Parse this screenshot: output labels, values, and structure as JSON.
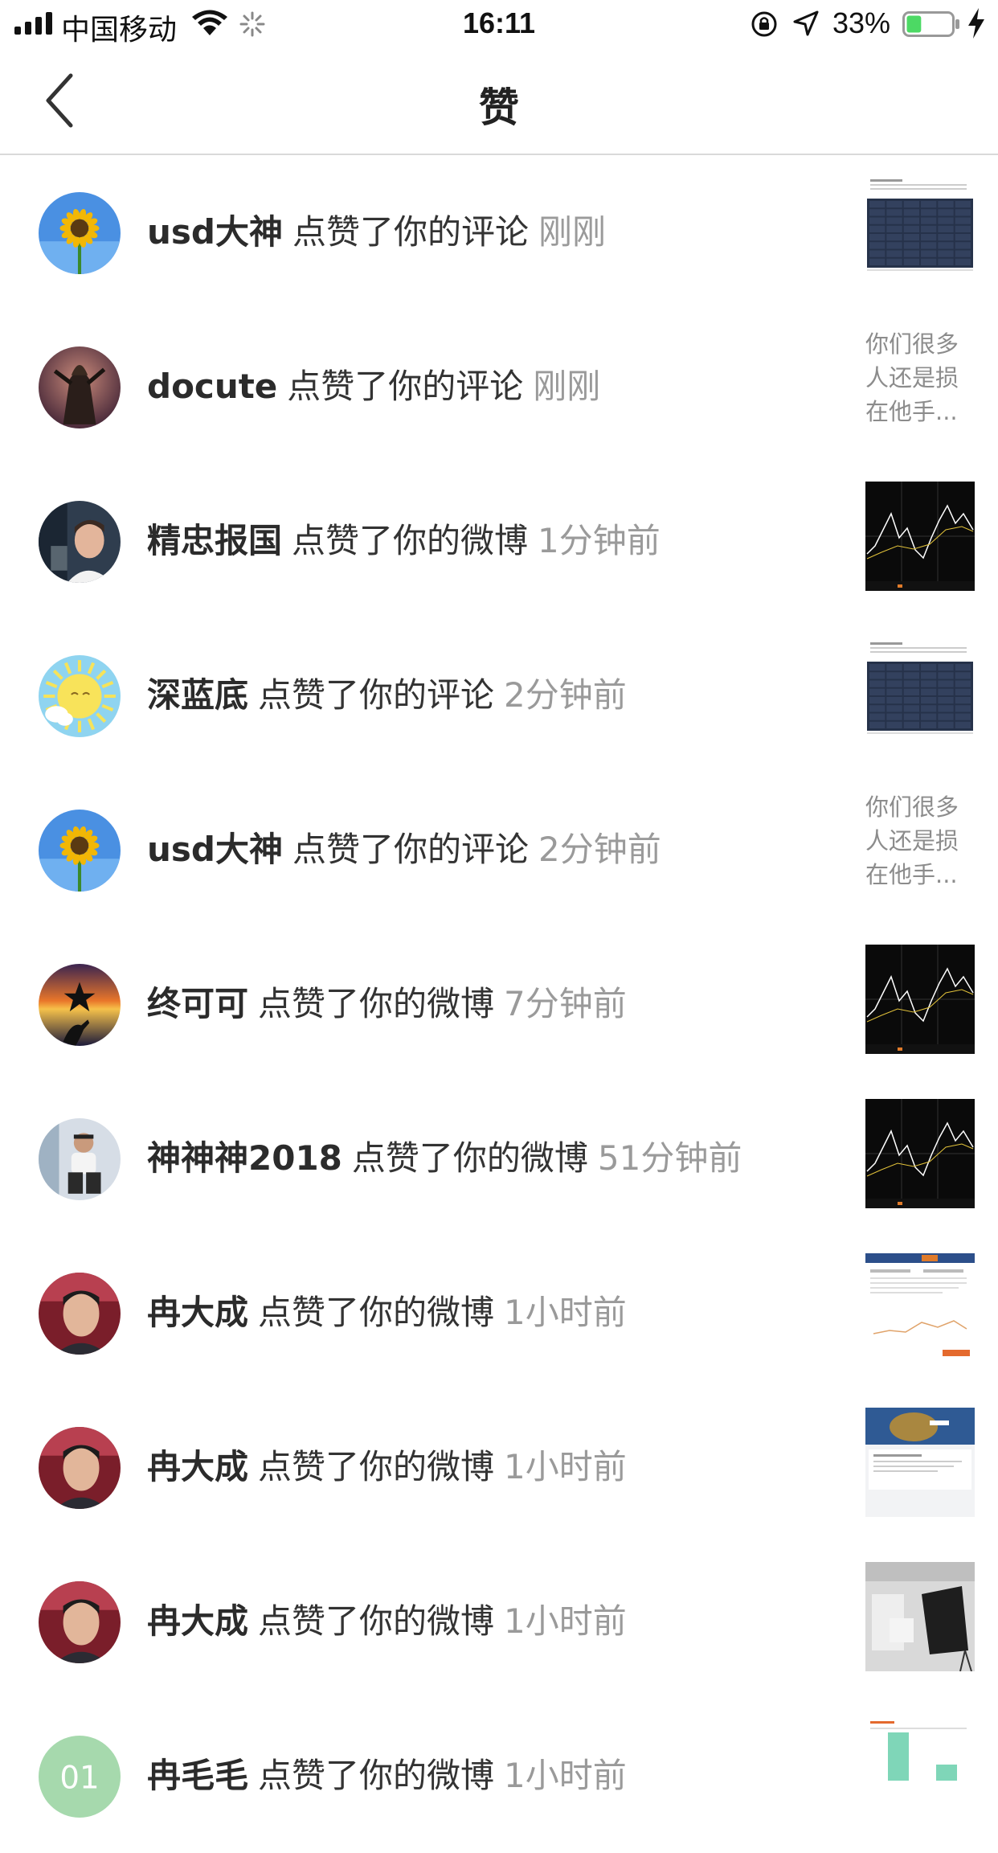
{
  "status_bar": {
    "carrier": "中国移动",
    "time": "16:11",
    "battery_percent": "33%",
    "battery_level": 0.33,
    "battery_color": "#4cd964"
  },
  "nav": {
    "title": "赞",
    "back_icon": "chevron-left-icon"
  },
  "notifications": [
    {
      "name": "usd大神",
      "action": "点赞了你的评论",
      "time": "刚刚",
      "avatar": "sunflower",
      "preview_type": "image",
      "preview": "table-screenshot"
    },
    {
      "name": "docute",
      "action": "点赞了你的评论",
      "time": "刚刚",
      "avatar": "warrior",
      "preview_type": "text",
      "preview": "你们很多人还是损在他手..."
    },
    {
      "name": "精忠报国",
      "action": "点赞了你的微博",
      "time": "1分钟前",
      "avatar": "man-office",
      "preview_type": "image",
      "preview": "dark-chart"
    },
    {
      "name": "深蓝底",
      "action": "点赞了你的评论",
      "time": "2分钟前",
      "avatar": "cartoon-sun",
      "preview_type": "image",
      "preview": "table-screenshot"
    },
    {
      "name": "usd大神",
      "action": "点赞了你的评论",
      "time": "2分钟前",
      "avatar": "sunflower",
      "preview_type": "text",
      "preview": "你们很多人还是损在他手..."
    },
    {
      "name": "终可可",
      "action": "点赞了你的微博",
      "time": "7分钟前",
      "avatar": "sunset",
      "preview_type": "image",
      "preview": "dark-chart"
    },
    {
      "name": "神神神2018",
      "action": "点赞了你的微博",
      "time": "51分钟前",
      "avatar": "man-sitting",
      "preview_type": "image",
      "preview": "dark-chart"
    },
    {
      "name": "冉大成",
      "action": "点赞了你的微博",
      "time": "1小时前",
      "avatar": "man-portrait",
      "preview_type": "image",
      "preview": "web-page"
    },
    {
      "name": "冉大成",
      "action": "点赞了你的微博",
      "time": "1小时前",
      "avatar": "man-portrait",
      "preview_type": "image",
      "preview": "web-page-2"
    },
    {
      "name": "冉大成",
      "action": "点赞了你的微博",
      "time": "1小时前",
      "avatar": "man-portrait",
      "preview_type": "image",
      "preview": "studio-photo"
    },
    {
      "name": "冉毛毛",
      "action": "点赞了你的微博",
      "time": "1小时前",
      "avatar": "green-01",
      "avatar_text": "01",
      "preview_type": "image",
      "preview": "bar-screenshot"
    }
  ]
}
